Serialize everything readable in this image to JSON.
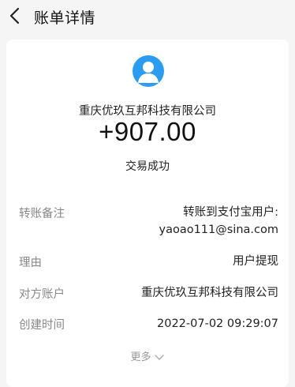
{
  "header": {
    "title": "账单详情",
    "back_icon": "chevron-left-icon"
  },
  "card": {
    "avatar_icon": "user-avatar-icon",
    "avatar_color": "#2c9cf1",
    "company": "重庆优玖互邦科技有限公司",
    "amount": "+907.00",
    "status": "交易成功"
  },
  "details": [
    {
      "label": "转账备注",
      "value_lines": [
        "转账到支付宝用户:",
        "yaoao111@sina.com"
      ]
    },
    {
      "label": "理由",
      "value": "用户提现"
    },
    {
      "label": "对方账户",
      "value": "重庆优玖互邦科技有限公司"
    },
    {
      "label": "创建时间",
      "value": "2022-07-02 09:29:07"
    }
  ],
  "more": {
    "label": "更多",
    "icon": "chevron-down-icon"
  }
}
